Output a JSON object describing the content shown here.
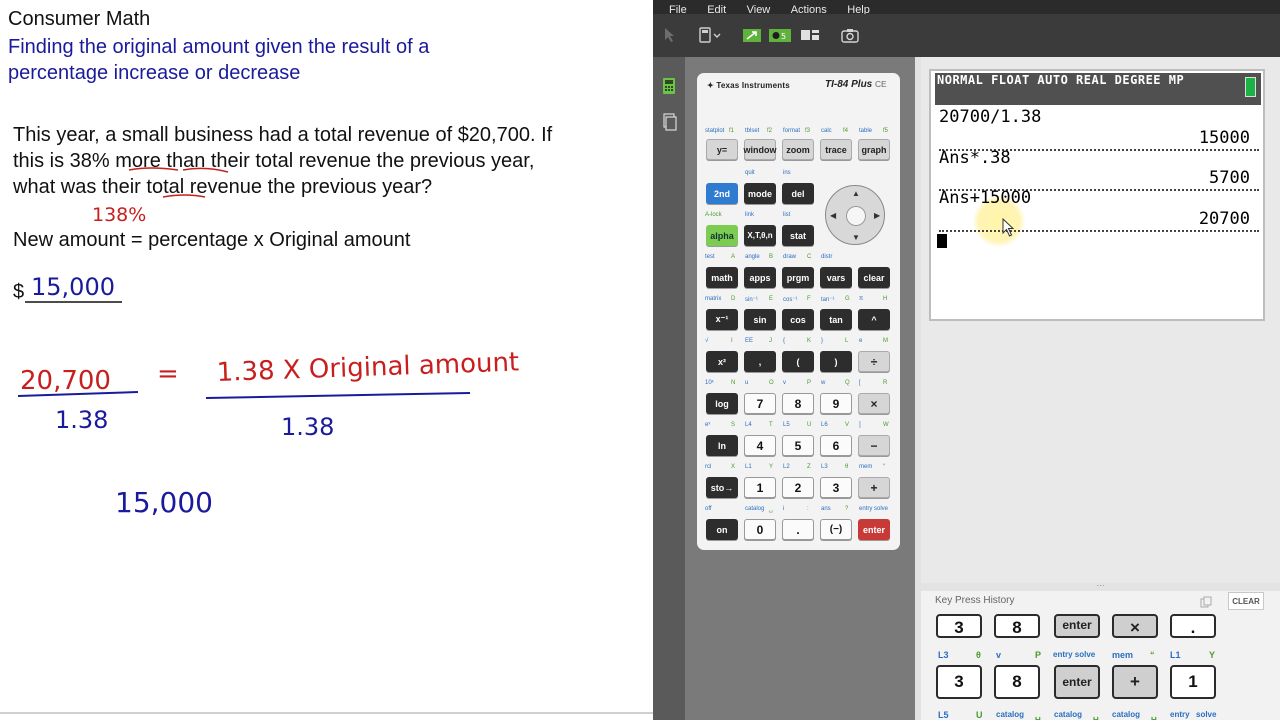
{
  "worksheet": {
    "title": "Consumer Math",
    "subtitle_line1": "Finding the original amount given the result of a",
    "subtitle_line2": "percentage increase or decrease",
    "problem_line1": "This year, a small business had a total revenue of $20,700.  If",
    "problem_line2": "this is 38% more than their total revenue the previous year,",
    "problem_line3": "what was their total revenue the previous year?",
    "formula": "New amount = percentage x Original amount",
    "dollar_sign": "$",
    "handwriting": {
      "percent_note": "138%",
      "answer_blank": "15,000",
      "eq_left": "20,700",
      "eq_equals": "=",
      "eq_right": "1.38  X Original amount",
      "divide_left": "1.38",
      "divide_right": "1.38",
      "result": "15,000"
    },
    "colors": {
      "title": "#111111",
      "subtitle": "#1a1a9c",
      "red_ink": "#c81e1e",
      "blue_ink": "#1a1a9c"
    }
  },
  "app": {
    "menu": [
      "File",
      "Edit",
      "View",
      "Actions",
      "Help"
    ],
    "calculator": {
      "brand": "Texas Instruments",
      "model": "TI-84 Plus",
      "model_suffix": "CE",
      "rows": [
        {
          "keys": [
            "y=",
            "window",
            "zoom",
            "trace",
            "graph"
          ],
          "second": [
            "statplot",
            "tblset",
            "format",
            "calc",
            "table"
          ],
          "alpha": [
            "f1",
            "f2",
            "f3",
            "f4",
            "f5"
          ]
        },
        {
          "keys": [
            "2nd",
            "mode",
            "del"
          ],
          "second": [
            "",
            "quit",
            "ins"
          ]
        },
        {
          "keys": [
            "alpha",
            "X,T,θ,n",
            "stat"
          ],
          "second": [
            "A-lock",
            "link",
            "list"
          ]
        },
        {
          "keys": [
            "math",
            "apps",
            "prgm",
            "vars",
            "clear"
          ],
          "second": [
            "test",
            "angle",
            "draw",
            "distr",
            ""
          ],
          "alpha": [
            "A",
            "B",
            "C",
            "",
            ""
          ]
        },
        {
          "keys": [
            "x⁻¹",
            "sin",
            "cos",
            "tan",
            "^"
          ],
          "second": [
            "matrix",
            "sin⁻¹",
            "cos⁻¹",
            "tan⁻¹",
            "π"
          ],
          "alpha": [
            "D",
            "E",
            "F",
            "G",
            "H"
          ]
        },
        {
          "keys": [
            "x²",
            ",",
            "(",
            ")",
            "÷"
          ],
          "second": [
            "√",
            "EE",
            "{",
            "}",
            "e"
          ],
          "alpha": [
            "I",
            "J",
            "K",
            "L",
            "M"
          ]
        },
        {
          "keys": [
            "log",
            "7",
            "8",
            "9",
            "×"
          ],
          "second": [
            "10ˣ",
            "u",
            "v",
            "w",
            "["
          ],
          "alpha": [
            "N",
            "O",
            "P",
            "Q",
            "R"
          ]
        },
        {
          "keys": [
            "ln",
            "4",
            "5",
            "6",
            "−"
          ],
          "second": [
            "eˣ",
            "L4",
            "L5",
            "L6",
            "]"
          ],
          "alpha": [
            "S",
            "T",
            "U",
            "V",
            "W"
          ]
        },
        {
          "keys": [
            "sto→",
            "1",
            "2",
            "3",
            "+"
          ],
          "second": [
            "rcl",
            "L1",
            "L2",
            "L3",
            "mem"
          ],
          "alpha": [
            "X",
            "Y",
            "Z",
            "θ",
            "“"
          ]
        },
        {
          "keys": [
            "on",
            "0",
            ".",
            "(−)",
            "enter"
          ],
          "second": [
            "off",
            "catalog",
            "i",
            "ans",
            "entry solve"
          ],
          "alpha": [
            "",
            "␣",
            ":",
            "?",
            ""
          ]
        }
      ]
    },
    "screen": {
      "status": "NORMAL FLOAT AUTO REAL DEGREE MP",
      "entries": [
        {
          "input": "20700/1.38",
          "output": "15000"
        },
        {
          "input": "Ans*.38",
          "output": "5700"
        },
        {
          "input": "Ans+15000",
          "output": "20700"
        }
      ]
    },
    "key_history": {
      "title": "Key Press History",
      "clear_label": "CLEAR",
      "top_row": [
        "3",
        "8",
        "enter",
        "×",
        "."
      ],
      "row_labels": [
        "L3",
        "θ",
        "v",
        "P",
        "entry solve",
        "mem",
        "“",
        "L1",
        "Y"
      ],
      "bottom_row": [
        "3",
        "8",
        "enter",
        "+",
        "1"
      ],
      "bottom_labels": [
        "L5",
        "U",
        "catalog",
        "␣",
        "catalog",
        "␣",
        "catalog",
        "␣",
        "entry",
        "solve"
      ]
    }
  }
}
